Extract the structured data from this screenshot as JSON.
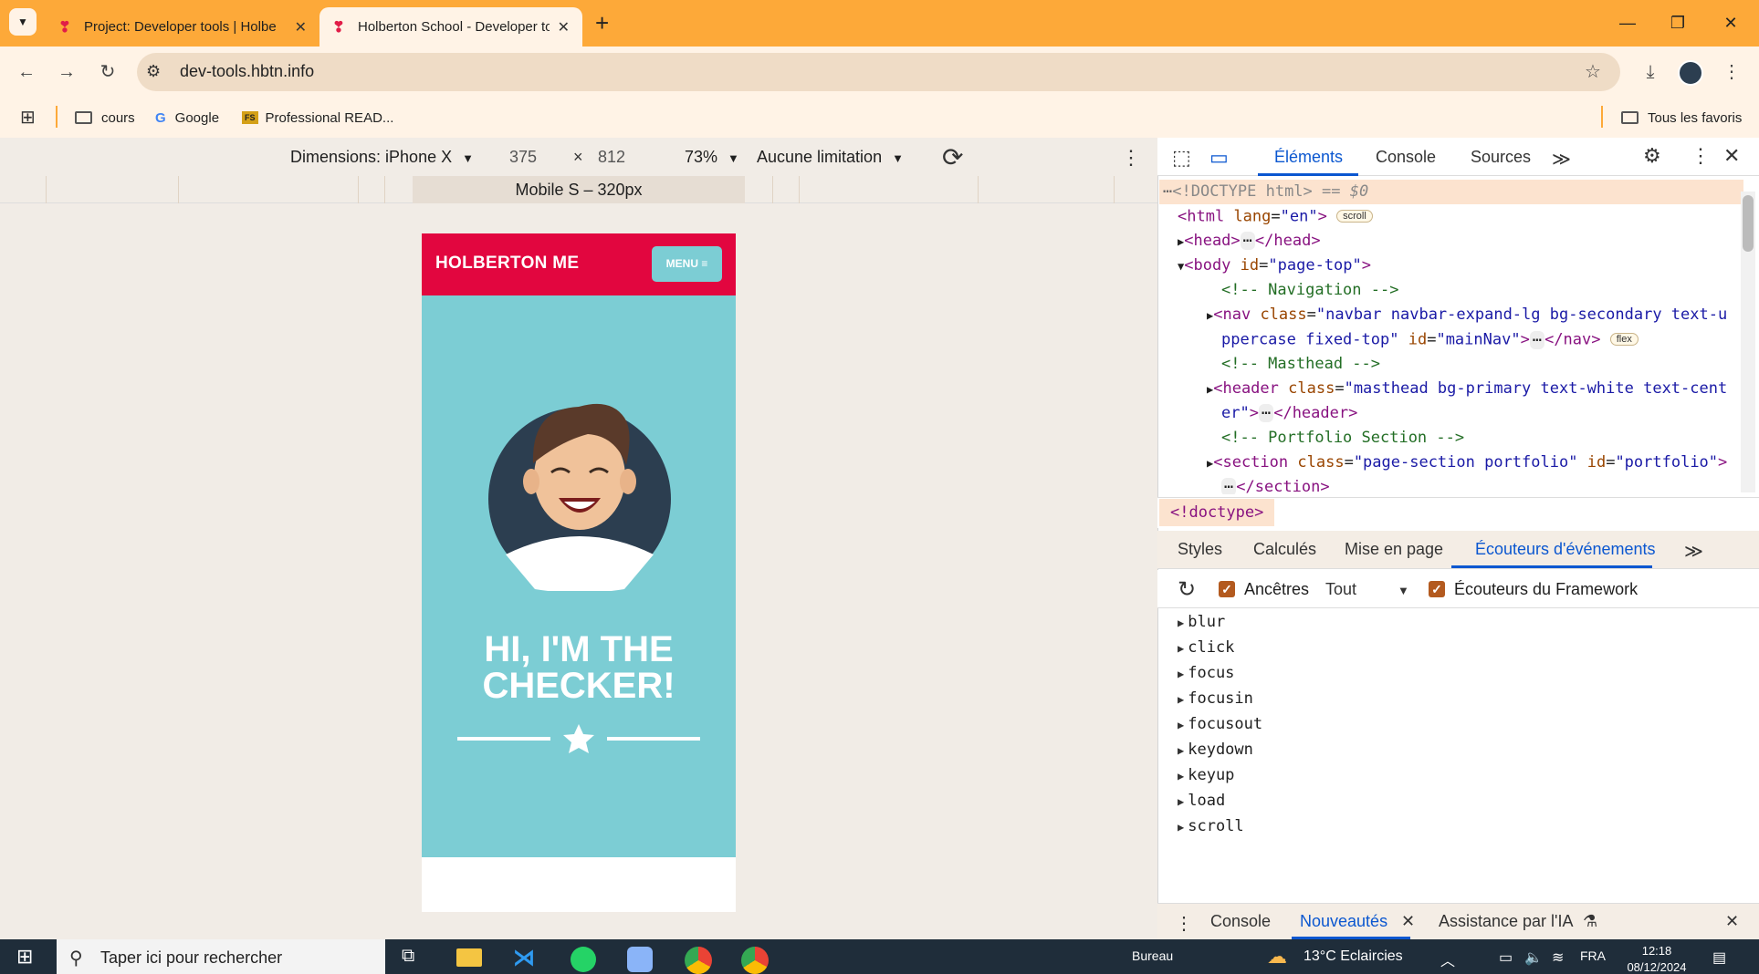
{
  "browser": {
    "tabs": [
      {
        "title": "Project: Developer tools | Holberton",
        "active": false
      },
      {
        "title": "Holberton School - Developer tools",
        "active": true
      }
    ],
    "new_tab_label": "+",
    "url": "dev-tools.hbtn.info",
    "bookmarks": [
      "cours",
      "Google",
      "Professional READ..."
    ],
    "all_bookmarks_label": "Tous les favoris"
  },
  "device_toolbar": {
    "dimensions_label": "Dimensions: iPhone X",
    "width": "375",
    "times": "×",
    "height": "812",
    "zoom": "73%",
    "throttling": "Aucune limitation",
    "media_query_label": "Mobile S – 320px"
  },
  "page": {
    "brand": "HOLBERTON ME",
    "menu_label": "MENU ≡",
    "hero_title_line1": "HI, I'M THE",
    "hero_title_line2": "CHECKER!"
  },
  "devtools": {
    "tabs": [
      "Éléments",
      "Console",
      "Sources"
    ],
    "more": "≫",
    "dom": {
      "doctype": "<!DOCTYPE html>",
      "doctype_suffix": " == $0",
      "html_open": "<html",
      "html_attr_name": "lang",
      "html_attr_value": "\"en\"",
      "scroll_pill": "scroll",
      "head": "<head>",
      "head_close": "</head>",
      "ellipsis": "⋯",
      "body_open": "<body",
      "body_attr_name": "id",
      "body_attr_value": "\"page-top\"",
      "comment_nav": "<!-- Navigation -->",
      "nav_open": "<nav",
      "nav_class_value_1": "\"navbar navbar-expand-lg bg-secondary text-u",
      "nav_class_value_2": "ppercase fixed-top\"",
      "nav_id_name": "id",
      "nav_id_value": "\"mainNav\"",
      "nav_close": "</nav>",
      "flex_pill": "flex",
      "comment_masthead": "<!-- Masthead -->",
      "header_open": "<header",
      "header_class_value_1": "\"masthead bg-primary text-white text-cent",
      "header_class_value_2": "er\"",
      "header_close": "</header>",
      "comment_portfolio": "<!-- Portfolio Section -->",
      "section_open": "<section",
      "section_class_value": "\"page-section portfolio\"",
      "section_id_value": "\"portfolio\"",
      "section_close": "</section>",
      "class_attr": "class",
      "gt": ">"
    },
    "breadcrumb": "<!doctype>",
    "subtabs": [
      "Styles",
      "Calculés",
      "Mise en page",
      "Écouteurs d'événements"
    ],
    "filters": {
      "ancestors_label": "Ancêtres",
      "scope": "Tout",
      "framework_label": "Écouteurs du Framework"
    },
    "events": [
      "blur",
      "click",
      "focus",
      "focusin",
      "focusout",
      "keydown",
      "keyup",
      "load",
      "scroll"
    ],
    "drawer_tabs": [
      "Console",
      "Nouveautés",
      "Assistance par l'IA"
    ]
  },
  "taskbar": {
    "search_placeholder": "Taper ici pour rechercher",
    "desktop_label": "Bureau",
    "weather": "13°C Eclaircies",
    "language": "FRA",
    "time": "12:18",
    "date": "08/12/2024"
  },
  "colors": {
    "tab_strip": "#fda939",
    "brand_red": "#e2063f",
    "hero_teal": "#7ccdd4",
    "accent_blue": "#0b57d0"
  }
}
